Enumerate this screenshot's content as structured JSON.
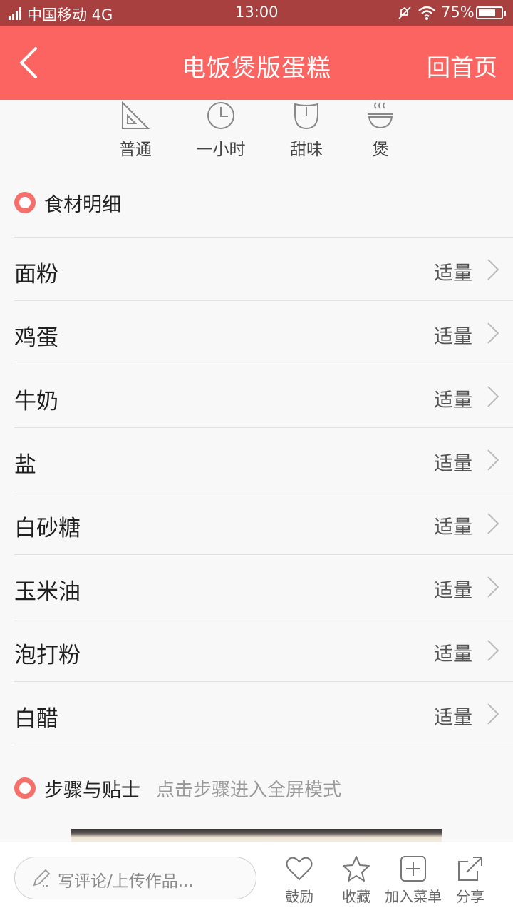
{
  "status_bar": {
    "carrier": "中国移动 4G",
    "time": "13:00",
    "battery_percent": "75%",
    "battery_level": 0.75,
    "icons": [
      "signal-icon",
      "mute-icon",
      "wifi-icon",
      "battery-icon"
    ]
  },
  "header": {
    "back_icon": "back-arrow-icon",
    "title": "电饭煲版蛋糕",
    "home_label": "回首页"
  },
  "attributes": [
    {
      "icon": "difficulty-icon",
      "label": "普通"
    },
    {
      "icon": "clock-icon",
      "label": "一小时"
    },
    {
      "icon": "taste-icon",
      "label": "甜味"
    },
    {
      "icon": "bowl-icon",
      "label": "煲"
    }
  ],
  "ingredients_section": {
    "title": "食材明细",
    "items": [
      {
        "name": "面粉",
        "amount": "适量"
      },
      {
        "name": "鸡蛋",
        "amount": "适量"
      },
      {
        "name": "牛奶",
        "amount": "适量"
      },
      {
        "name": "盐",
        "amount": "适量"
      },
      {
        "name": "白砂糖",
        "amount": "适量"
      },
      {
        "name": "玉米油",
        "amount": "适量"
      },
      {
        "name": "泡打粉",
        "amount": "适量"
      },
      {
        "name": "白醋",
        "amount": "适量"
      }
    ]
  },
  "steps_section": {
    "title": "步骤与贴士",
    "hint": "点击步骤进入全屏模式"
  },
  "bottom_bar": {
    "comment_placeholder": "写评论/上传作品...",
    "actions": [
      {
        "icon": "heart-icon",
        "label": "鼓励"
      },
      {
        "icon": "star-icon",
        "label": "收藏"
      },
      {
        "icon": "add-menu-icon",
        "label": "加入菜单"
      },
      {
        "icon": "share-icon",
        "label": "分享"
      }
    ]
  },
  "colors": {
    "header": "#fb6460",
    "status_bar": "#a8403f",
    "accent_dot": "#f6706b",
    "background": "#f8f8f8"
  }
}
